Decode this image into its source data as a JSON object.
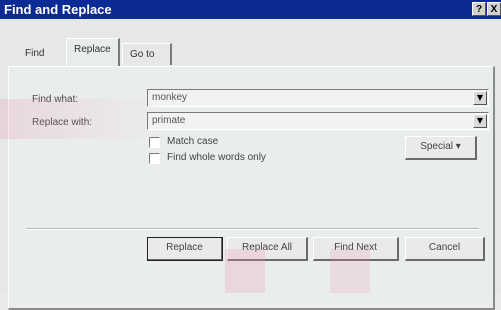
{
  "window": {
    "title": "Find and Replace",
    "help_glyph": "?",
    "close_glyph": "X"
  },
  "tabs": [
    {
      "label": "Find"
    },
    {
      "label": "Replace"
    },
    {
      "label": "Go to"
    }
  ],
  "find_field": {
    "label": "Find what:",
    "value": "monkey"
  },
  "replace_field": {
    "label": "Replace with:",
    "value": "primate"
  },
  "options": {
    "match_case": "Match case",
    "whole_words": "Find whole words only"
  },
  "buttons": {
    "special": "Special  ▾",
    "replace": "Replace",
    "replace_all": "Replace All",
    "find_next": "Find Next",
    "cancel": "Cancel"
  },
  "colors": {
    "title_bar": "#0c2a94",
    "field_bg": "#f2f2f2"
  }
}
